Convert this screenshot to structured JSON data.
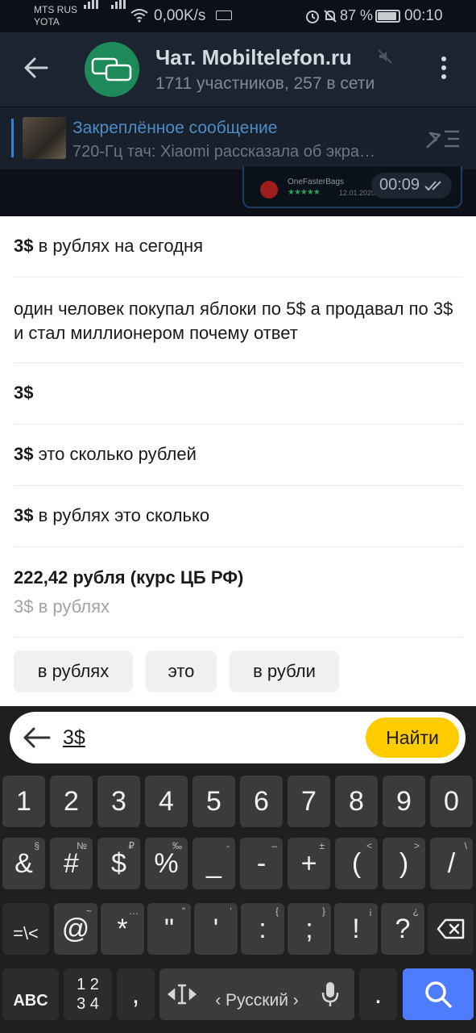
{
  "status_bar": {
    "carrier_1": "MTS RUS",
    "carrier_2": "YOTA",
    "net_speed": "0,00K/s",
    "battery_percent": "87 %",
    "battery_level": 0.87,
    "time": "00:10"
  },
  "chat_header": {
    "title": "Чат. Mobiltelefon.ru",
    "subtitle": "1711 участников, 257 в сети"
  },
  "pinned": {
    "title": "Закреплённое сообщение",
    "text": "720-Гц тач: Xiaomi рассказала об экра…"
  },
  "message_preview": {
    "brand": "OneFasterBags",
    "stars": "★★★★★",
    "date": "12.01.2020",
    "time": "00:09"
  },
  "suggestions": [
    {
      "bold": "3$",
      "rest": " в рублях на сегодня"
    },
    {
      "bold": "",
      "rest": "один человек покупал яблоки по 5$ а продавал по 3$ и стал миллионером почему ответ"
    },
    {
      "bold": "3$",
      "rest": ""
    },
    {
      "bold": "3$",
      "rest": " это сколько рублей"
    },
    {
      "bold": "3$",
      "rest": " в рублях это сколько"
    }
  ],
  "answer": {
    "value": "222,42 рубля (курс ЦБ РФ)",
    "label": "3$ в рублях"
  },
  "chips": [
    "в рублях",
    "это",
    "в рубли"
  ],
  "search": {
    "query": "3$",
    "button_label": "Найти"
  },
  "keyboard": {
    "row1": [
      "1",
      "2",
      "3",
      "4",
      "5",
      "6",
      "7",
      "8",
      "9",
      "0"
    ],
    "row2": [
      {
        "main": "&",
        "sub": "§"
      },
      {
        "main": "#",
        "sub": "№"
      },
      {
        "main": "$",
        "sub": "₽"
      },
      {
        "main": "%",
        "sub": "‰"
      },
      {
        "main": "_",
        "sub": "-"
      },
      {
        "main": "-",
        "sub": "–"
      },
      {
        "main": "+",
        "sub": "±"
      },
      {
        "main": "(",
        "sub": "<"
      },
      {
        "main": ")",
        "sub": ">"
      },
      {
        "main": "/",
        "sub": "\\"
      }
    ],
    "row3": [
      {
        "main": "@",
        "sub": "~"
      },
      {
        "main": "*",
        "sub": "…"
      },
      {
        "main": "\"",
        "sub": "″"
      },
      {
        "main": "'",
        "sub": "‘"
      },
      {
        "main": ":",
        "sub": "{"
      },
      {
        "main": ";",
        "sub": "}"
      },
      {
        "main": "!",
        "sub": "¡"
      },
      {
        "main": "?",
        "sub": "¿"
      }
    ],
    "eq_key": "=\\<",
    "abc_key": "ABC",
    "num_key_top": "1 2",
    "num_key_bottom": "3 4",
    "comma_key": ",",
    "space_label": "‹ Русский ›",
    "period_key": ".",
    "icons": [
      "backspace-icon",
      "cursor-icon",
      "microphone-icon",
      "search-icon"
    ]
  }
}
